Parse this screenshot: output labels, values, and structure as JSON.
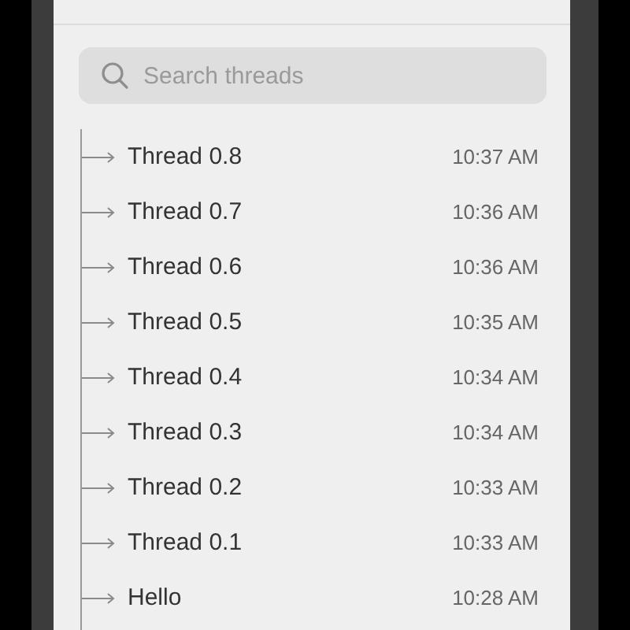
{
  "search": {
    "placeholder": "Search threads"
  },
  "threads": [
    {
      "title": "Thread 0.8",
      "time": "10:37 AM"
    },
    {
      "title": "Thread 0.7",
      "time": "10:36 AM"
    },
    {
      "title": "Thread 0.6",
      "time": "10:36 AM"
    },
    {
      "title": "Thread 0.5",
      "time": "10:35 AM"
    },
    {
      "title": "Thread 0.4",
      "time": "10:34 AM"
    },
    {
      "title": "Thread 0.3",
      "time": "10:34 AM"
    },
    {
      "title": "Thread 0.2",
      "time": "10:33 AM"
    },
    {
      "title": "Thread 0.1",
      "time": "10:33 AM"
    },
    {
      "title": "Hello",
      "time": "10:28 AM"
    }
  ]
}
